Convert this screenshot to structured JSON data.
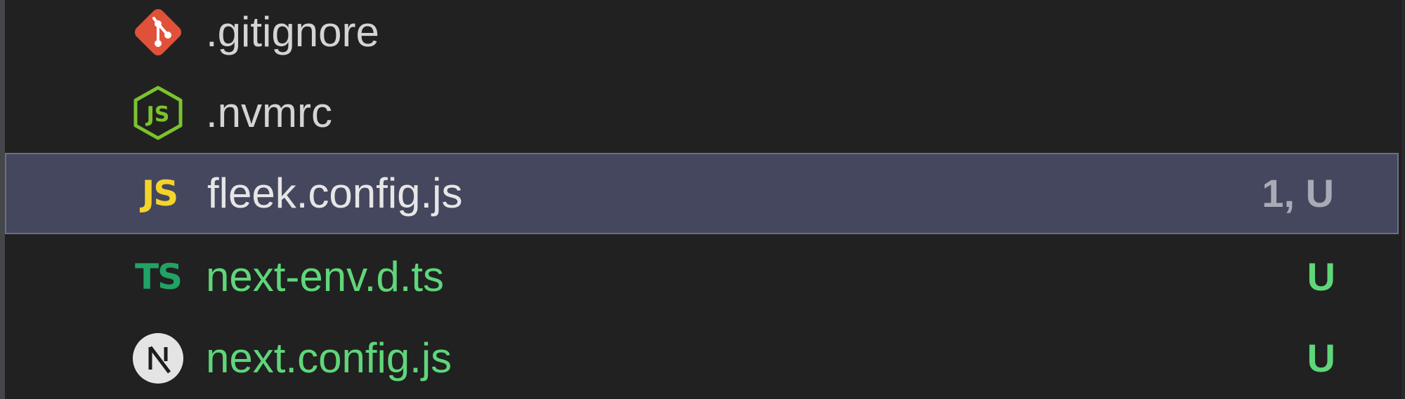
{
  "files": [
    {
      "name": ".gitignore",
      "icon": "git-icon",
      "status": "",
      "untracked": false,
      "selected": false
    },
    {
      "name": ".nvmrc",
      "icon": "nodejs-icon",
      "status": "",
      "untracked": false,
      "selected": false
    },
    {
      "name": "fleek.config.js",
      "icon": "javascript-icon",
      "icon_text": "JS",
      "status": "1, U",
      "untracked": false,
      "selected": true
    },
    {
      "name": "next-env.d.ts",
      "icon": "typescript-icon",
      "icon_text": "TS",
      "status": "U",
      "untracked": true,
      "selected": false
    },
    {
      "name": "next.config.js",
      "icon": "nextjs-icon",
      "status": "U",
      "untracked": true,
      "selected": false
    }
  ],
  "colors": {
    "background": "#212121",
    "selected_background": "#44475d",
    "untracked_text": "#5fd67a",
    "javascript_icon": "#f5d42a",
    "typescript_icon": "#21a366",
    "git_icon": "#e0513a",
    "node_icon": "#7cc22e"
  }
}
